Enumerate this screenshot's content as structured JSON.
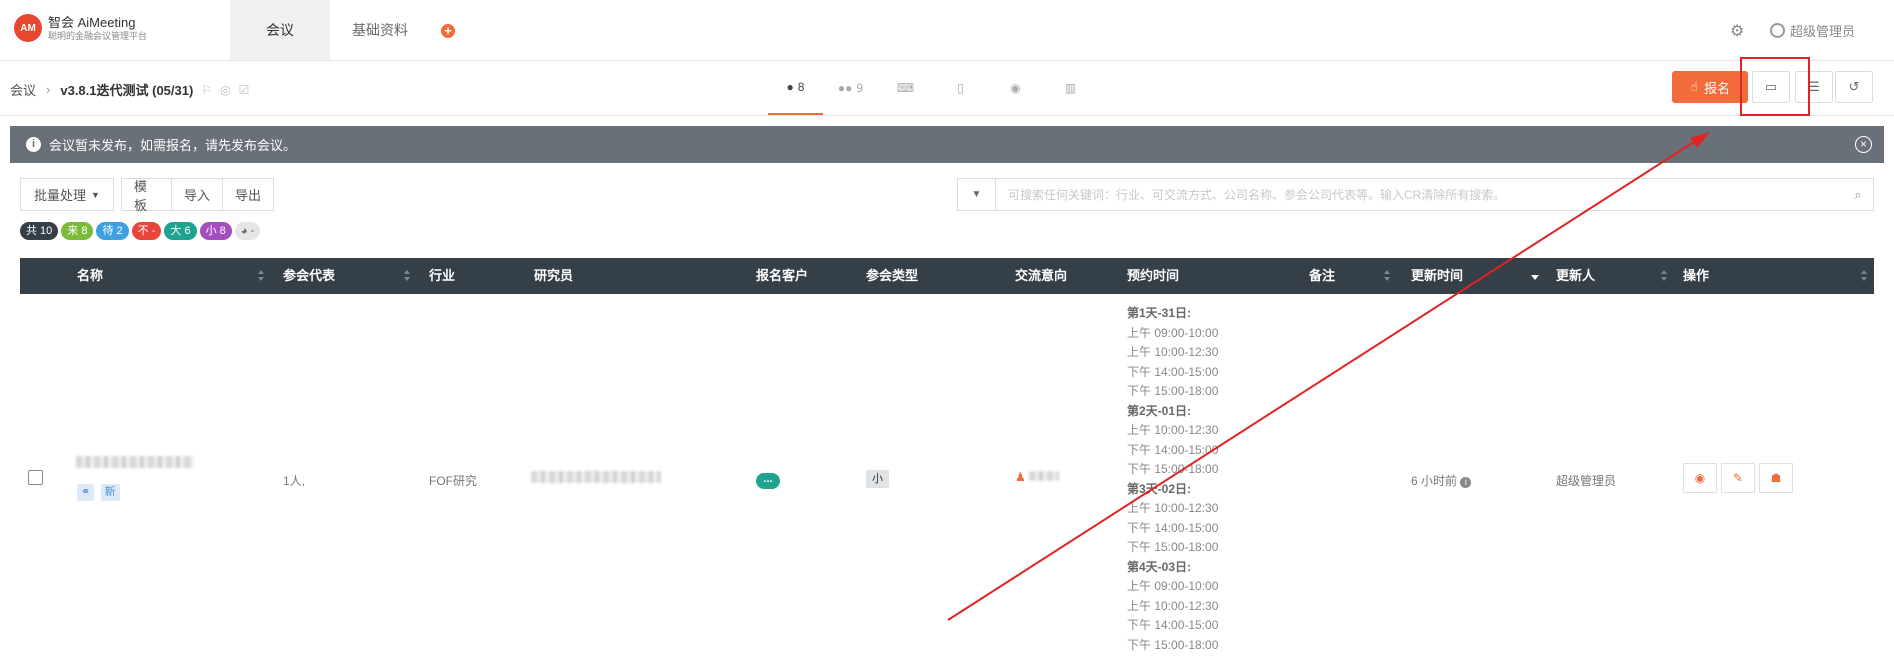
{
  "app": {
    "logo_mark": "AM",
    "name": "智会 AiMeeting",
    "tagline": "聪明的金融会议管理平台"
  },
  "nav": {
    "tabs": [
      {
        "label": "会议",
        "active": true
      },
      {
        "label": "基础资料",
        "active": false
      }
    ],
    "user_name": "超级管理员"
  },
  "breadcrumb": {
    "root": "会议",
    "title": "v3.8.1迭代测试 (05/31)"
  },
  "content_tabs": [
    {
      "icon": "person-icon",
      "count": "8",
      "active": true
    },
    {
      "icon": "group-icon",
      "count": "9",
      "active": false
    },
    {
      "icon": "keyboard-icon",
      "count": "",
      "active": false
    },
    {
      "icon": "device-icon",
      "count": "",
      "active": false
    },
    {
      "icon": "camera-icon",
      "count": "",
      "active": false
    },
    {
      "icon": "chart-icon",
      "count": "",
      "active": false
    }
  ],
  "actions": {
    "signup_label": "报名"
  },
  "banner": {
    "message": "会议暂未发布，如需报名，请先发布会议。"
  },
  "toolbar": {
    "batch_label": "批量处理",
    "template_label": "模板",
    "import_label": "导入",
    "export_label": "导出"
  },
  "search": {
    "placeholder": "可搜索任何关键词：行业、可交流方式、公司名称、参会公司代表等。输入CR清除所有搜索。"
  },
  "status_badges": [
    {
      "label": "共 10",
      "color": "#343f48"
    },
    {
      "label": "来 8",
      "color": "#7cba3c"
    },
    {
      "label": "待 2",
      "color": "#3fa0e0"
    },
    {
      "label": "不 -",
      "color": "#e8463a"
    },
    {
      "label": "大 6",
      "color": "#1fa38e"
    },
    {
      "label": "小 8",
      "color": "#a44ec0"
    },
    {
      "label": "-",
      "color": "#e4e6e8"
    }
  ],
  "table": {
    "columns": [
      "名称",
      "参会代表",
      "行业",
      "研究员",
      "报名客户",
      "参会类型",
      "交流意向",
      "预约时间",
      "备注",
      "更新时间",
      "更新人",
      "操作"
    ],
    "rows": [
      {
        "tag_new": "新",
        "representative": "1人,",
        "industry": "FOF研究",
        "signup_customer": "...",
        "meeting_type": "小",
        "schedule": [
          {
            "day": "第1天-31日:",
            "slots": [
              "上午 09:00-10:00",
              "上午 10:00-12:30",
              "下午 14:00-15:00",
              "下午 15:00-18:00"
            ]
          },
          {
            "day": "第2天-01日:",
            "slots": [
              "上午 10:00-12:30",
              "下午 14:00-15:00",
              "下午 15:00-18:00"
            ]
          },
          {
            "day": "第3天-02日:",
            "slots": [
              "上午 10:00-12:30",
              "下午 14:00-15:00",
              "下午 15:00-18:00"
            ]
          },
          {
            "day": "第4天-03日:",
            "slots": [
              "上午 09:00-10:00",
              "上午 10:00-12:30",
              "下午 14:00-15:00",
              "下午 15:00-18:00"
            ]
          }
        ],
        "updated_time": "6 小时前",
        "updated_by": "超级管理员"
      }
    ]
  },
  "annotation": {
    "color": "#e02323"
  }
}
